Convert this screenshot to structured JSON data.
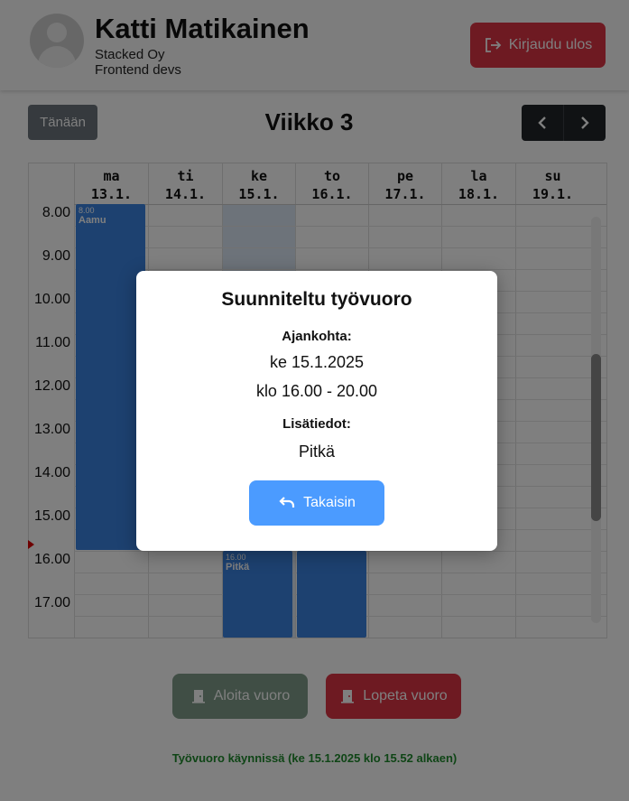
{
  "header": {
    "user_name": "Katti Matikainen",
    "company": "Stacked Oy",
    "team": "Frontend devs",
    "logout_label": "Kirjaudu ulos"
  },
  "toolbar": {
    "today_label": "Tänään",
    "week_title": "Viikko 3"
  },
  "calendar": {
    "days": [
      {
        "name": "ma",
        "date": "13.1."
      },
      {
        "name": "ti",
        "date": "14.1."
      },
      {
        "name": "ke",
        "date": "15.1."
      },
      {
        "name": "to",
        "date": "16.1."
      },
      {
        "name": "pe",
        "date": "17.1."
      },
      {
        "name": "la",
        "date": "18.1."
      },
      {
        "name": "su",
        "date": "19.1."
      }
    ],
    "hours": [
      "8.00",
      "9.00",
      "10.00",
      "11.00",
      "12.00",
      "13.00",
      "14.00",
      "15.00",
      "16.00",
      "17.00"
    ],
    "events": [
      {
        "day": "ma",
        "time": "8.00",
        "title": "Aamu"
      },
      {
        "day": "ke",
        "time": "16.00",
        "title": "Pitkä"
      },
      {
        "day": "to",
        "time": "",
        "title": ""
      }
    ]
  },
  "actions": {
    "start_label": "Aloita vuoro",
    "end_label": "Lopeta vuoro",
    "status": "Työvuoro käynnissä (ke 15.1.2025 klo 15.52 alkaen)"
  },
  "modal": {
    "title": "Suunniteltu työvuoro",
    "time_label": "Ajankohta:",
    "date": "ke 15.1.2025",
    "time_range": "klo 16.00 - 20.00",
    "info_label": "Lisätiedot:",
    "info": "Pitkä",
    "back_label": "Takaisin"
  },
  "colors": {
    "accent_blue": "#4b9bff",
    "danger": "#dc3545",
    "event_blue": "#3b82e0",
    "status_green": "#1f8a2d"
  }
}
